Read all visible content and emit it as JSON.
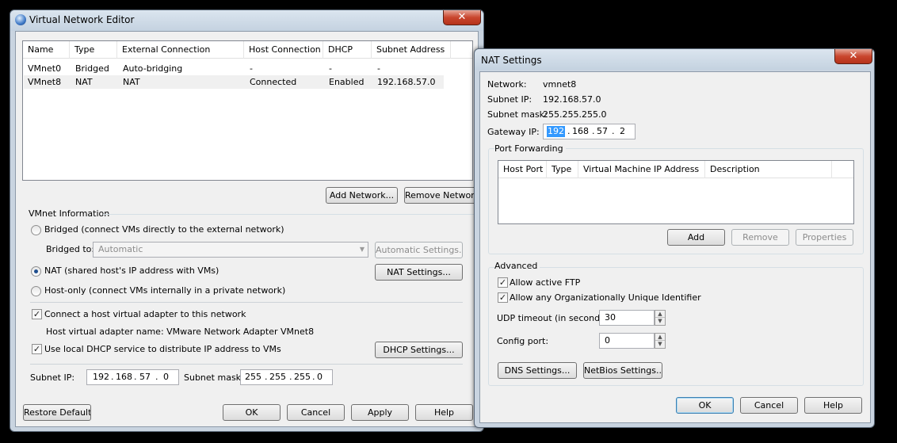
{
  "vne": {
    "title": "Virtual Network Editor",
    "close_label": "✕",
    "columns": [
      "Name",
      "Type",
      "External Connection",
      "Host Connection",
      "DHCP",
      "Subnet Address"
    ],
    "rows": [
      [
        "VMnet0",
        "Bridged",
        "Auto-bridging",
        "-",
        "-",
        "-"
      ],
      [
        "VMnet8",
        "NAT",
        "NAT",
        "Connected",
        "Enabled",
        "192.168.57.0"
      ]
    ],
    "add_network": "Add Network...",
    "remove_network": "Remove Network",
    "vmnet_info": "VMnet Information",
    "bridged_label": "Bridged (connect VMs directly to the external network)",
    "bridged_to_label": "Bridged to:",
    "bridged_to_value": "Automatic",
    "automatic_settings": "Automatic Settings...",
    "nat_label": "NAT (shared host's IP address with VMs)",
    "nat_settings": "NAT Settings...",
    "hostonly_label": "Host-only (connect VMs internally in a private network)",
    "connect_adapter_label": "Connect a host virtual adapter to this network",
    "adapter_name": "Host virtual adapter name: VMware Network Adapter VMnet8",
    "dhcp_label": "Use local DHCP service to distribute IP address to VMs",
    "dhcp_settings": "DHCP Settings...",
    "subnet_ip_label": "Subnet IP:",
    "subnet_ip": [
      "192",
      "168",
      "57",
      "0"
    ],
    "subnet_mask_label": "Subnet mask:",
    "subnet_mask": [
      "255",
      "255",
      "255",
      "0"
    ],
    "restore_default": "Restore Default",
    "ok": "OK",
    "cancel": "Cancel",
    "apply": "Apply",
    "help": "Help",
    "selected_mode": "NAT",
    "connect_adapter_checked": true,
    "dhcp_checked": true
  },
  "nat": {
    "title": "NAT Settings",
    "close_label": "✕",
    "network_label": "Network:",
    "network_value": "vmnet8",
    "subnet_ip_label": "Subnet IP:",
    "subnet_ip_value": "192.168.57.0",
    "subnet_mask_label": "Subnet mask:",
    "subnet_mask_value": "255.255.255.0",
    "gateway_label": "Gateway IP:",
    "gateway": [
      "192",
      "168",
      "57",
      "2"
    ],
    "port_forwarding": "Port Forwarding",
    "pf_columns": [
      "Host Port",
      "Type",
      "Virtual Machine IP Address",
      "Description"
    ],
    "add": "Add",
    "remove": "Remove",
    "properties": "Properties",
    "advanced": "Advanced",
    "allow_ftp": "Allow active FTP",
    "allow_oui": "Allow any Organizationally Unique Identifier",
    "udp_timeout_label": "UDP timeout (in seconds):",
    "udp_timeout_value": "30",
    "config_port_label": "Config port:",
    "config_port_value": "0",
    "dns_settings": "DNS Settings...",
    "netbios_settings": "NetBios Settings...",
    "ok": "OK",
    "cancel": "Cancel",
    "help": "Help",
    "allow_ftp_checked": true,
    "allow_oui_checked": true
  },
  "colors": {
    "window_frame": "#c9d4e0",
    "client_bg": "#f0f0f0",
    "close_red": "#c9462e",
    "selection_blue": "#3399ff"
  }
}
